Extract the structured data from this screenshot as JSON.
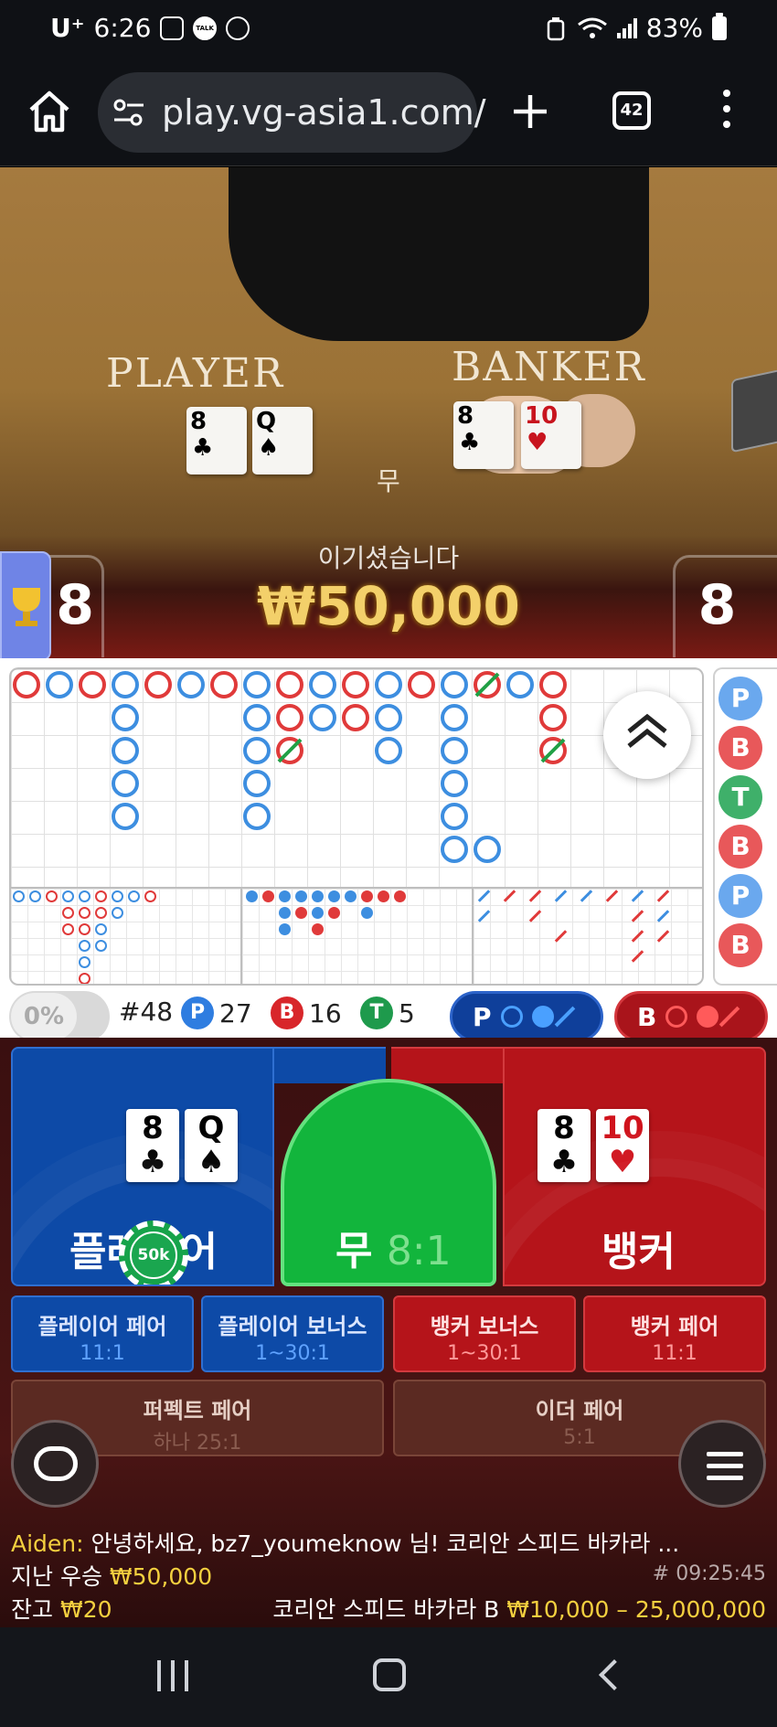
{
  "status_bar": {
    "carrier": "U⁺",
    "time": "6:26",
    "battery": "83%"
  },
  "browser": {
    "url": "play.vg-asia1.com/",
    "tab_count": "42"
  },
  "table": {
    "player_label": "PLAYER",
    "banker_label": "BANKER",
    "player_cards": [
      {
        "rank": "8",
        "suit": "♣",
        "color": "black"
      },
      {
        "rank": "Q",
        "suit": "♠",
        "color": "black"
      }
    ],
    "banker_cards": [
      {
        "rank": "8",
        "suit": "♣",
        "color": "black"
      },
      {
        "rank": "10",
        "suit": "♥",
        "color": "red"
      }
    ],
    "tie_mark": "무",
    "result_text": "이기셨습니다",
    "win_amount": "₩50,000",
    "player_score": "8",
    "banker_score": "8"
  },
  "stats": {
    "percent": "0%",
    "round": "#48",
    "player_label": "P",
    "player_count": "27",
    "banker_label": "B",
    "banker_count": "16",
    "tie_label": "T",
    "tie_count": "5",
    "predict_player": "P",
    "predict_banker": "B"
  },
  "history_strip": [
    "P",
    "B",
    "T",
    "B",
    "P",
    "B"
  ],
  "bets": {
    "player": "플레이어",
    "tie": "무",
    "tie_odds": "8:1",
    "banker": "뱅커",
    "chip": "50k",
    "side": [
      {
        "name": "플레이어 페어",
        "odds": "11:1"
      },
      {
        "name": "플레이어 보너스",
        "odds": "1~30:1"
      },
      {
        "name": "뱅커 보너스",
        "odds": "1~30:1"
      },
      {
        "name": "뱅커 페어",
        "odds": "11:1"
      }
    ],
    "perfect_pair": {
      "name": "퍼펙트 페어",
      "odds": "하나 25:1"
    },
    "either_pair": {
      "name": "이더 페어",
      "odds": "5:1"
    }
  },
  "footer": {
    "chat_user": "Aiden:",
    "chat_message": "안녕하세요, bz7_youmeknow 님! 코리안 스피드 바카라 ...",
    "last_win_label": "지난 우승",
    "last_win_value": "₩50,000",
    "round_id": "# 09:25:45",
    "balance_label": "잔고",
    "balance_value": "₩20",
    "table_name": "코리안 스피드 바카라 B",
    "limits": "₩10,000 – 25,000,000"
  },
  "colors": {
    "player_blue": "#0d4aa7",
    "banker_red": "#b5141a",
    "tie_green": "#12b53c",
    "gold": "#f4d03f"
  }
}
